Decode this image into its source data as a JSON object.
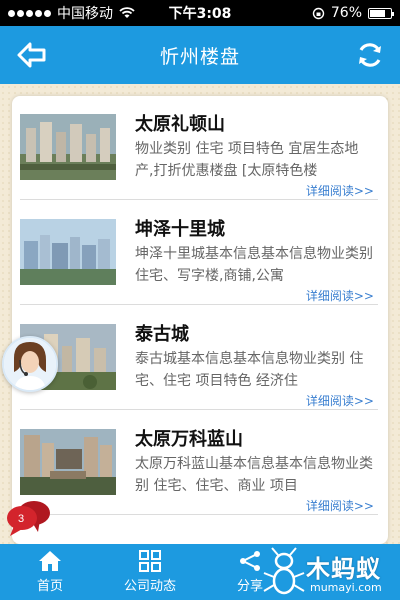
{
  "status_bar": {
    "carrier": "中国移动",
    "time": "下午3:08",
    "battery": "76%",
    "battery_level": 0.76
  },
  "header": {
    "title": "忻州楼盘"
  },
  "listings": [
    {
      "title": "太原礼顿山",
      "description": "物业类别 住宅 项目特色 宜居生态地产,打折优惠楼盘 [太原特色楼",
      "more": "详细阅读>>"
    },
    {
      "title": "坤泽十里城",
      "description": "坤泽十里城基本信息基本信息物业类别 住宅、写字楼,商铺,公寓",
      "more": "详细阅读>>"
    },
    {
      "title": "泰古城",
      "description": "泰古城基本信息基本信息物业类别 住宅、住宅 项目特色 经济住",
      "more": "详细阅读>>"
    },
    {
      "title": "太原万科蓝山",
      "description": "太原万科蓝山基本信息基本信息物业类别 住宅、住宅、商业 项目",
      "more": "详细阅读>>"
    }
  ],
  "chat": {
    "badge_count": "3"
  },
  "tab_bar": {
    "tabs": [
      {
        "label": "首页",
        "icon": "home-icon"
      },
      {
        "label": "公司动态",
        "icon": "grid-icon"
      },
      {
        "label": "分享",
        "icon": "share-icon"
      },
      {
        "label": "",
        "icon": ""
      }
    ]
  },
  "watermark": {
    "text": "木蚂蚁",
    "sub": "mumayi.com"
  },
  "colors": {
    "accent": "#1d9ae0",
    "link": "#3a7fd0",
    "background": "#f3ead6"
  }
}
